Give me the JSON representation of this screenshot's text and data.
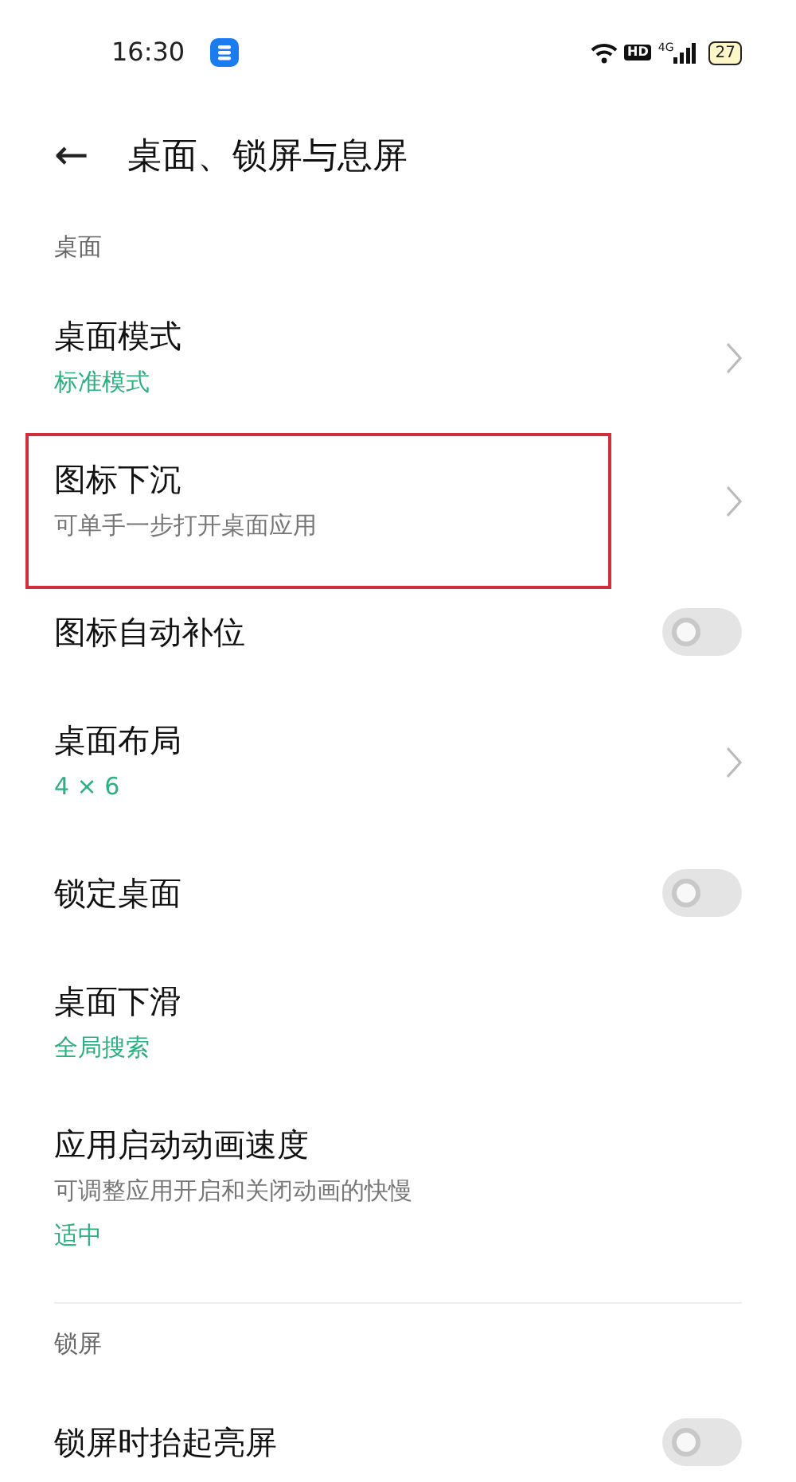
{
  "status_bar": {
    "time": "16:30",
    "hd": "HD",
    "network": "4G",
    "battery": "27"
  },
  "header": {
    "back": "←",
    "title": "桌面、锁屏与息屏"
  },
  "sections": [
    {
      "label": "桌面",
      "divider_after": true,
      "items": [
        {
          "kind": "link",
          "title": "桌面模式",
          "value": "标准模式",
          "highlighted": false
        },
        {
          "kind": "link",
          "title": "图标下沉",
          "subtitle": "可单手一步打开桌面应用",
          "highlighted": true
        },
        {
          "kind": "toggle",
          "title": "图标自动补位",
          "on": false,
          "highlighted": false
        },
        {
          "kind": "link",
          "title": "桌面布局",
          "value": "4 × 6",
          "highlighted": false
        },
        {
          "kind": "toggle",
          "title": "锁定桌面",
          "on": false,
          "highlighted": false
        },
        {
          "kind": "plain",
          "title": "桌面下滑",
          "value": "全局搜索",
          "highlighted": false
        },
        {
          "kind": "plain",
          "title": "应用启动动画速度",
          "subtitle": "可调整应用开启和关闭动画的快慢",
          "value": "适中",
          "highlighted": false
        }
      ]
    },
    {
      "label": "锁屏",
      "divider_after": false,
      "items": [
        {
          "kind": "toggle",
          "title": "锁屏时抬起亮屏",
          "on": false,
          "highlighted": false
        }
      ]
    }
  ]
}
